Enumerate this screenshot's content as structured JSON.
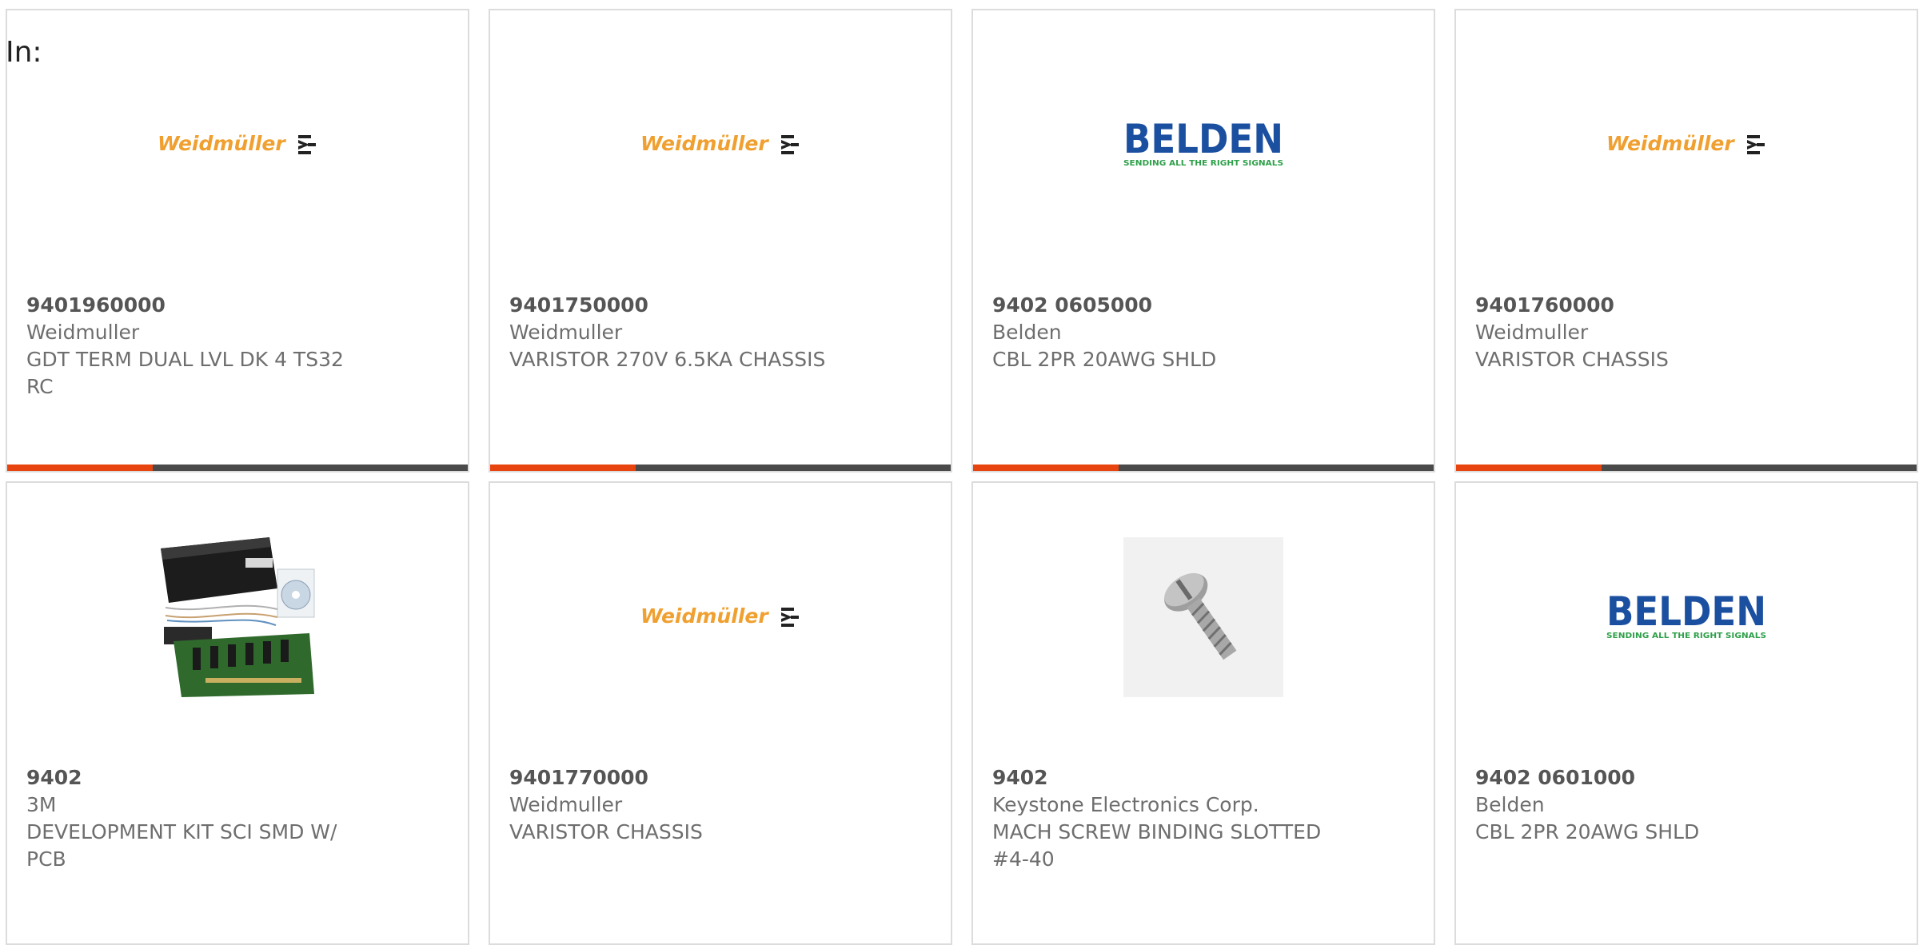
{
  "filter_label": "In:",
  "colors": {
    "accent": "#e8440f",
    "bar_dark": "#4a4a4a",
    "weidmuller_orange": "#f0a030",
    "belden_blue": "#1b4fa0",
    "belden_green": "#2fa04a"
  },
  "logos": {
    "weidmuller_text": "Weidmüller",
    "belden_text": "BELDEN",
    "belden_tagline": "SENDING ALL THE RIGHT SIGNALS"
  },
  "products": [
    {
      "part": "9401960000",
      "manufacturer": "Weidmuller",
      "desc1": "GDT TERM DUAL LVL DK 4 TS32",
      "desc2": "RC",
      "image": "weidmuller-logo"
    },
    {
      "part": "9401750000",
      "manufacturer": "Weidmuller",
      "desc1": "VARISTOR 270V 6.5KA CHASSIS",
      "desc2": "",
      "image": "weidmuller-logo"
    },
    {
      "part": "9402 0605000",
      "manufacturer": "Belden",
      "desc1": "CBL 2PR 20AWG SHLD",
      "desc2": "",
      "image": "belden-logo"
    },
    {
      "part": "9401760000",
      "manufacturer": "Weidmuller",
      "desc1": "VARISTOR CHASSIS",
      "desc2": "",
      "image": "weidmuller-logo"
    },
    {
      "part": "9402",
      "manufacturer": "3M",
      "desc1": "DEVELOPMENT KIT SCI SMD W/",
      "desc2": "PCB",
      "image": "dev-kit-photo"
    },
    {
      "part": "9401770000",
      "manufacturer": "Weidmuller",
      "desc1": "VARISTOR CHASSIS",
      "desc2": "",
      "image": "weidmuller-logo"
    },
    {
      "part": "9402",
      "manufacturer": "Keystone Electronics Corp.",
      "desc1": "MACH SCREW BINDING SLOTTED",
      "desc2": "#4-40",
      "image": "screw-photo"
    },
    {
      "part": "9402 0601000",
      "manufacturer": "Belden",
      "desc1": "CBL 2PR 20AWG SHLD",
      "desc2": "",
      "image": "belden-logo"
    }
  ]
}
